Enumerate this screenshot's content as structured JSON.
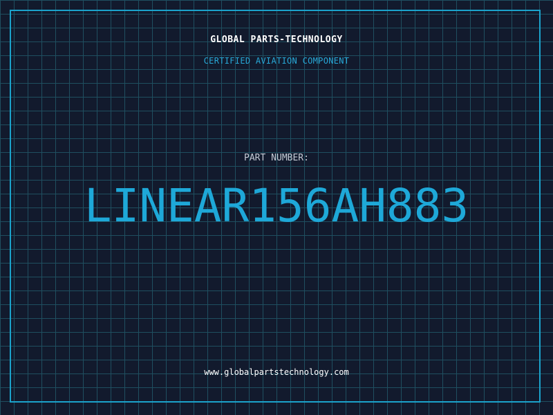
{
  "header": {
    "company_name": "GLOBAL PARTS-TECHNOLOGY",
    "tagline": "CERTIFIED AVIATION COMPONENT"
  },
  "part": {
    "label": "PART NUMBER:",
    "number": "LINEAR156AH883"
  },
  "footer": {
    "website": "www.globalpartstechnology.com"
  },
  "colors": {
    "background": "#121a2d",
    "grid": "#1f4f60",
    "accent": "#1ea8d8",
    "frame": "#1ba3cc",
    "label_text": "#c5ccd6",
    "title_text": "#ffffff"
  }
}
